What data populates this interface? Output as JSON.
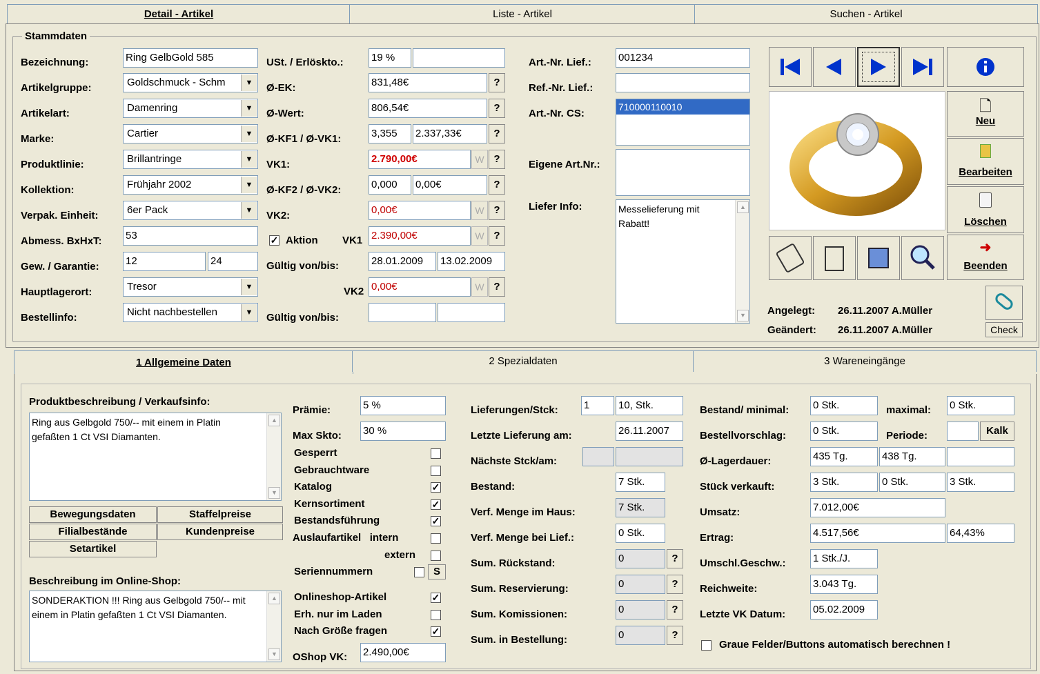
{
  "top_tabs": [
    "Detail - Artikel",
    "Liste - Artikel",
    "Suchen - Artikel"
  ],
  "stammdaten": {
    "title": "Stammdaten",
    "labels": {
      "bezeichnung": "Bezeichnung:",
      "artikelgruppe": "Artikelgruppe:",
      "artikelart": "Artikelart:",
      "marke": "Marke:",
      "produktlinie": "Produktlinie:",
      "kollektion": "Kollektion:",
      "verpak": "Verpak. Einheit:",
      "abmess": "Abmess. BxHxT:",
      "gew": "Gew. / Garantie:",
      "hauptlager": "Hauptlagerort:",
      "bestellinfo": "Bestellinfo:"
    },
    "values": {
      "bezeichnung": "Ring GelbGold 585",
      "artikelgruppe": "Goldschmuck - Schm",
      "artikelart": "Damenring",
      "marke": "Cartier",
      "produktlinie": "Brillantringe",
      "kollektion": "Frühjahr 2002",
      "verpak": "6er Pack",
      "abmess": "53",
      "gewicht": "12",
      "garantie": "24",
      "hauptlager": "Tresor",
      "bestellinfo": "Nicht nachbestellen"
    },
    "price_labels": {
      "ust": "USt. / Erlöskto.:",
      "ek": "Ø-EK:",
      "wert": "Ø-Wert:",
      "kf1": "Ø-KF1 / Ø-VK1:",
      "vk1": "VK1:",
      "kf2": "Ø-KF2 / Ø-VK2:",
      "vk2": "VK2:",
      "aktion": "Aktion",
      "aktion_vk1": "VK1",
      "gueltig1": "Gültig von/bis:",
      "aktion_vk2": "VK2",
      "gueltig2": "Gültig von/bis:"
    },
    "price_values": {
      "ust": "19 %",
      "erloeskto": "",
      "ek": "831,48€",
      "wert": "806,54€",
      "kf1": "3,355",
      "vk1_avg": "2.337,33€",
      "vk1": "2.790,00€",
      "kf2": "0,000",
      "vk2_avg": "0,00€",
      "vk2": "0,00€",
      "aktion_vk1": "2.390,00€",
      "von1": "28.01.2009",
      "bis1": "13.02.2009",
      "aktion_vk2": "0,00€",
      "von2": "",
      "bis2": ""
    },
    "ref_labels": {
      "artnr_lief": "Art.-Nr. Lief.:",
      "refnr_lief": "Ref.-Nr. Lief.:",
      "artnr_cs": "Art.-Nr. CS:",
      "eigene": "Eigene Art.Nr.:",
      "liefer_info": "Liefer Info:"
    },
    "ref_values": {
      "artnr_lief": "001234",
      "refnr_lief": "",
      "artnr_cs": "710000110010",
      "eigene": "",
      "liefer_info": "Messelieferung mit Rabatt!"
    },
    "btn_w": "W",
    "btn_q": "?",
    "actions": {
      "neu": "Neu",
      "bearbeiten": "Bearbeiten",
      "loeschen": "Löschen",
      "beenden": "Beenden",
      "check": "Check"
    },
    "meta": {
      "angelegt_label": "Angelegt:",
      "angelegt": "26.11.2007 A.Müller",
      "geaendert_label": "Geändert:",
      "geaendert": "26.11.2007 A.Müller"
    }
  },
  "sub_tabs": [
    "1 Allgemeine Daten",
    "2 Spezialdaten",
    "3 Wareneingänge"
  ],
  "allgemein": {
    "produktbeschreibung_label": "Produktbeschreibung / Verkaufsinfo:",
    "produktbeschreibung": "Ring aus Gelbgold 750/-- mit einem in Platin gefaßten 1 Ct VSI Diamanten.",
    "buttons": {
      "bewegungsdaten": "Bewegungsdaten",
      "staffelpreise": "Staffelpreise",
      "filialbestaende": "Filialbestände",
      "kundenpreise": "Kundenpreise",
      "setartikel": "Setartikel"
    },
    "online_label": "Beschreibung im Online-Shop:",
    "online_text": "SONDERAKTION !!! Ring aus Gelbgold 750/-- mit einem in Platin gefaßten 1 Ct VSI Diamanten.",
    "praemie_label": "Prämie:",
    "praemie": "5 %",
    "maxskto_label": "Max Skto:",
    "maxskto": "30 %",
    "flags": [
      {
        "label": "Gesperrt",
        "checked": false
      },
      {
        "label": "Gebrauchtware",
        "checked": false
      },
      {
        "label": "Katalog",
        "checked": true
      },
      {
        "label": "Kernsortiment",
        "checked": true
      },
      {
        "label": "Bestandsführung",
        "checked": true
      },
      {
        "label": "Auslaufartikel   intern",
        "checked": false
      },
      {
        "label": "extern",
        "checked": false
      },
      {
        "label": "Seriennummern",
        "checked": false
      }
    ],
    "s_btn": "S",
    "shop_flags": [
      {
        "label": "Onlineshop-Artikel",
        "checked": true
      },
      {
        "label": "Erh. nur im Laden",
        "checked": false
      },
      {
        "label": "Nach Größe fragen",
        "checked": true
      }
    ],
    "oshop_label": "OShop VK:",
    "oshop_vk": "2.490,00€",
    "lief": {
      "lieferungen_label": "Lieferungen/Stck:",
      "lieferungen": "1",
      "lieferungen_stk": "10, Stk.",
      "letzte_label": "Letzte Lieferung am:",
      "letzte": "26.11.2007",
      "naechste_label": "Nächste Stck/am:",
      "bestand_label": "Bestand:",
      "bestand": "7 Stk.",
      "verf_haus_label": "Verf. Menge im Haus:",
      "verf_haus": "7 Stk.",
      "verf_lief_label": "Verf. Menge bei Lief.:",
      "verf_lief": "0 Stk.",
      "rueckstand_label": "Sum. Rückstand:",
      "rueckstand": "0",
      "reservierung_label": "Sum. Reservierung:",
      "reservierung": "0",
      "kommission_label": "Sum. Komissionen:",
      "kommission": "0",
      "bestellung_label": "Sum. in Bestellung:",
      "bestellung": "0"
    },
    "stats": {
      "bestand_min_label": "Bestand/ minimal:",
      "bestand_min": "0 Stk.",
      "maximal_label": "maximal:",
      "maximal": "0 Stk.",
      "vorschlag_label": "Bestellvorschlag:",
      "vorschlag": "0 Stk.",
      "periode_label": "Periode:",
      "periode": "",
      "kalk": "Kalk",
      "lagerdauer_label": "Ø-Lagerdauer:",
      "lagerdauer1": "435 Tg.",
      "lagerdauer2": "438 Tg.",
      "lagerdauer3": "",
      "verkauft_label": "Stück verkauft:",
      "verkauft1": "3 Stk.",
      "verkauft2": "0 Stk.",
      "verkauft3": "3 Stk.",
      "umsatz_label": "Umsatz:",
      "umsatz": "7.012,00€",
      "ertrag_label": "Ertrag:",
      "ertrag": "4.517,56€",
      "ertrag_pct": "64,43%",
      "umschl_label": "Umschl.Geschw.:",
      "umschl": "1 Stk./J.",
      "reichweite_label": "Reichweite:",
      "reichweite": "3.043 Tg.",
      "letzte_vk_label": "Letzte VK Datum:",
      "letzte_vk": "05.02.2009",
      "auto_label": "Graue Felder/Buttons automatisch berechnen !"
    }
  }
}
